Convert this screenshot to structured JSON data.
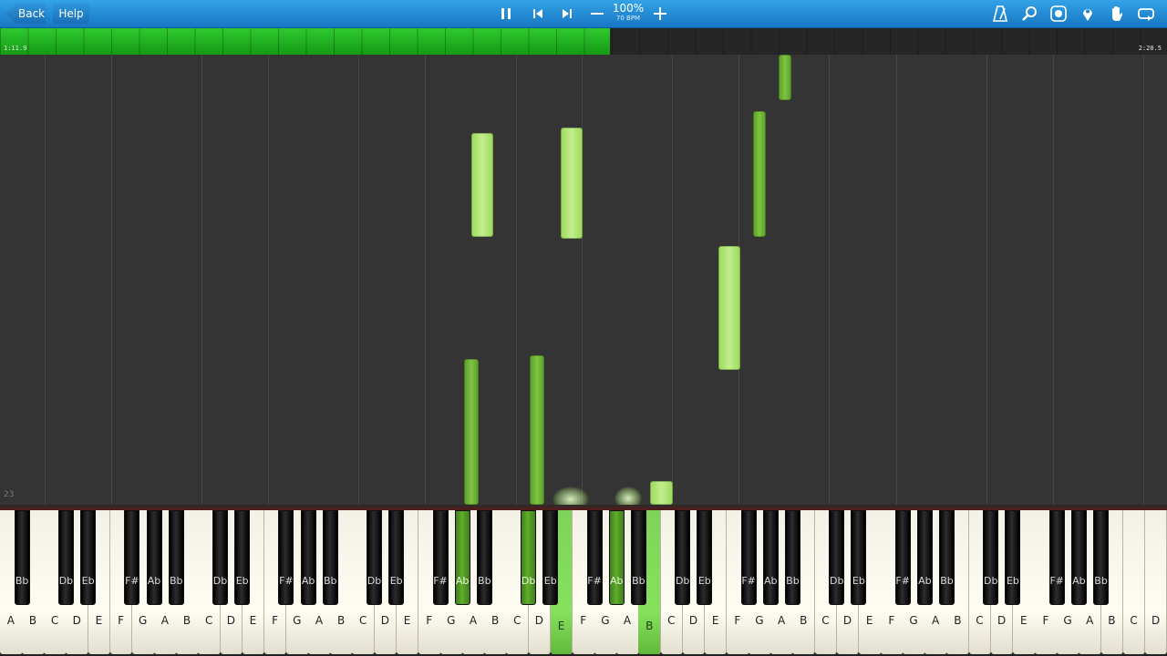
{
  "toolbar": {
    "back_label": "Back",
    "help_label": "Help",
    "tempo_percent": "100%",
    "tempo_bpm": "70 BPM",
    "icons": {
      "pause": "pause-icon",
      "previous": "skip-back-icon",
      "next": "skip-forward-icon",
      "minus": "minus-icon",
      "plus": "plus-icon",
      "metronome": "metronome-icon",
      "search": "search-icon",
      "note_labels": "note-label-icon",
      "marker": "location-pin-icon",
      "hand": "hand-icon",
      "loop": "loop-icon"
    }
  },
  "progress": {
    "current": "1:11.9",
    "total": "2:20.5",
    "fraction": 0.523
  },
  "roll": {
    "measure": "23"
  },
  "colors": {
    "toolbar": "#1d86d2",
    "progress": "#1fb11f",
    "note_light": "#b2e67a",
    "note_dark": "#6fb236",
    "background": "#343434"
  },
  "keyboard": {
    "white_keys": [
      "A",
      "B",
      "C",
      "D",
      "E",
      "F",
      "G",
      "A",
      "B",
      "C",
      "D",
      "E",
      "F",
      "G",
      "A",
      "B",
      "C",
      "D",
      "E",
      "F",
      "G",
      "A",
      "B",
      "C",
      "D",
      "E",
      "F",
      "G",
      "A",
      "B",
      "C",
      "D",
      "E",
      "F",
      "G",
      "A",
      "B",
      "C",
      "D",
      "E",
      "F",
      "G",
      "A",
      "B",
      "C",
      "D",
      "E",
      "F",
      "G",
      "A",
      "B",
      "C",
      "D"
    ],
    "black_keys": [
      "Bb",
      "Db",
      "Eb",
      "F#",
      "Ab",
      "Bb",
      "Db",
      "Eb",
      "F#",
      "Ab",
      "Bb",
      "Db",
      "Eb",
      "F#",
      "Ab",
      "Bb",
      "Db",
      "Eb",
      "F#",
      "Ab",
      "Bb",
      "Db",
      "Eb",
      "F#",
      "Ab",
      "Bb",
      "Db",
      "Eb",
      "F#",
      "Ab",
      "Bb",
      "Db",
      "Eb",
      "F#",
      "Ab",
      "Bb"
    ],
    "pressed_white": [
      25,
      29
    ],
    "pressed_black": [
      14,
      16,
      19
    ]
  }
}
